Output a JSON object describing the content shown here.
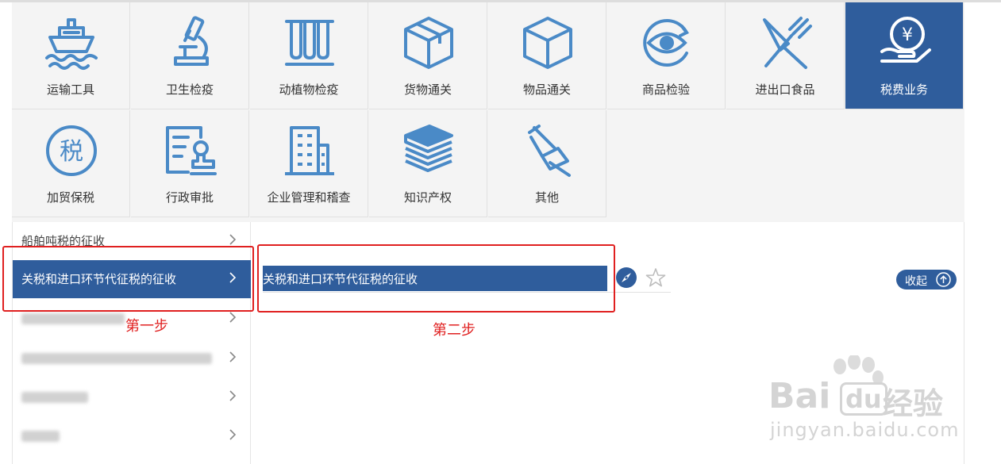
{
  "categories": [
    {
      "label": "运输工具",
      "icon": "ship-icon"
    },
    {
      "label": "卫生检疫",
      "icon": "microscope-icon"
    },
    {
      "label": "动植物检疫",
      "icon": "test-tubes-icon"
    },
    {
      "label": "货物通关",
      "icon": "package-icon"
    },
    {
      "label": "物品通关",
      "icon": "cube-icon"
    },
    {
      "label": "商品检验",
      "icon": "eye-inspection-icon"
    },
    {
      "label": "进出口食品",
      "icon": "fork-knife-icon"
    },
    {
      "label": "税费业务",
      "icon": "yuan-hand-icon",
      "active": true
    },
    {
      "label": "加贸保税",
      "icon": "tax-circle-icon"
    },
    {
      "label": "行政审批",
      "icon": "approval-stamp-icon"
    },
    {
      "label": "企业管理和稽查",
      "icon": "building-icon"
    },
    {
      "label": "知识产权",
      "icon": "books-icon"
    },
    {
      "label": "其他",
      "icon": "pushpin-icon"
    }
  ],
  "tax_circle_glyph": "税",
  "yuan_glyph": "¥",
  "submenu": {
    "items": [
      {
        "label": "船舶吨税的征收"
      },
      {
        "label": "关税和进口环节代征税的征收",
        "active": true
      }
    ]
  },
  "result": {
    "label": "关税和进口环节代征税的征收",
    "collapse_label": "收起"
  },
  "annotations": {
    "step1": "第一步",
    "step2": "第二步"
  },
  "watermark": {
    "brand_latin": "Bai",
    "brand_box": "du",
    "brand_cn": "经验",
    "url": "jingyan.baidu.com"
  },
  "colors": {
    "accent": "#2f5d9c",
    "icon": "#4a8ac7",
    "annotation": "#e02020",
    "tile_bg": "#f4f4f4"
  }
}
